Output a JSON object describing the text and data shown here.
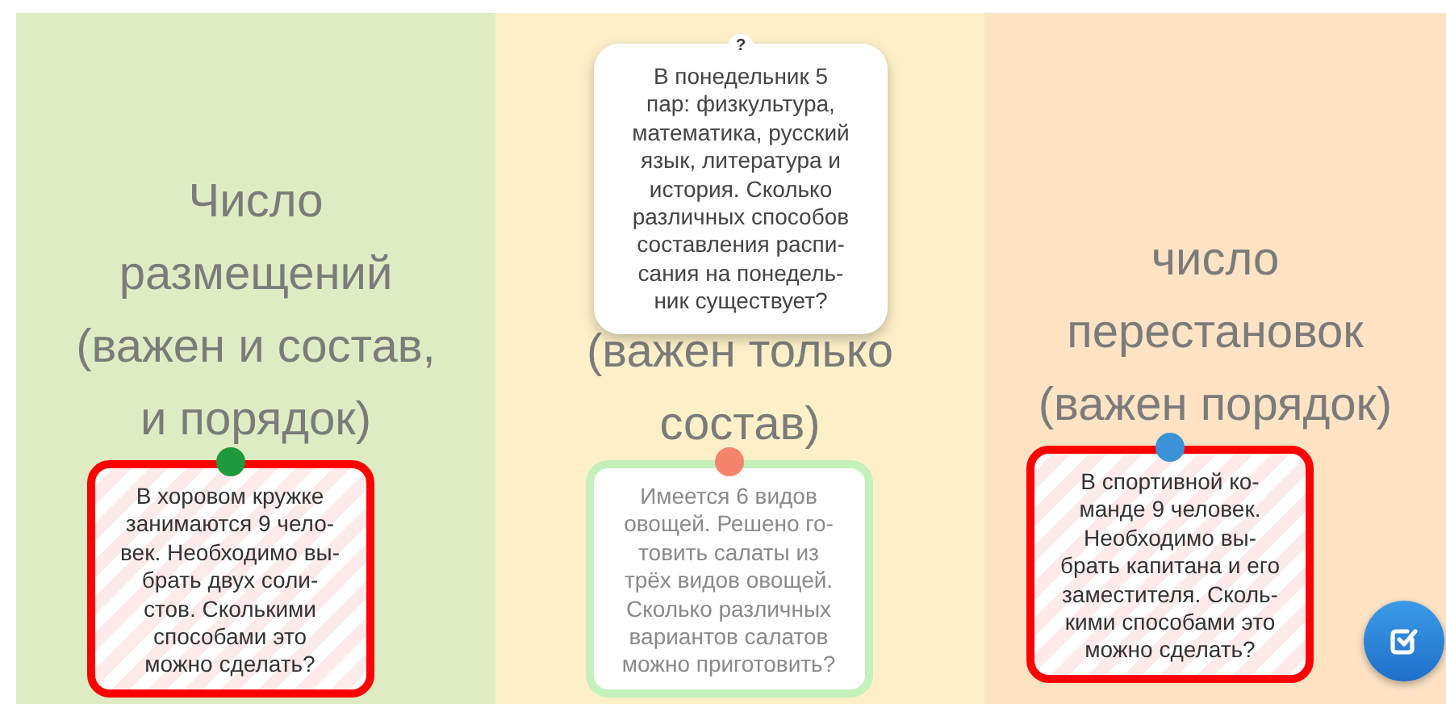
{
  "columns": [
    {
      "heading": "Число размещений (важен и состав, и порядок)",
      "card": {
        "text": "В хоровом кружке\nзанимаются 9 чело-\nвек. Необходимо вы-\nбрать двух соли-\nстов. Сколькими\nспособами это\nможно сделать?",
        "marked_wrong": true,
        "color": "#1e9a3c"
      }
    },
    {
      "heading": "(важен только состав)",
      "card": {
        "text": "Имеется 6 видов\nовощей. Решено го-\nтовить салаты из\nтрёх видов овощей.\nСколько различных\nвариантов салатов\nможно приготовить?",
        "marked_wrong": false,
        "color": "#f4846a"
      }
    },
    {
      "heading": "число перестановок (важен порядок)",
      "card": {
        "text": "В спортивной ко-\nманде 9 человек.\nНеобходимо вы-\nбрать капитана и его\nзаместителя. Сколь-\nкими способами это\nможно сделать?",
        "marked_wrong": true,
        "color": "#3a93d6"
      }
    }
  ],
  "question": {
    "marker": "?",
    "text": "В понедельник 5\nпар: физкультура,\nматематика, русский\nязык, литература и\nистория. Сколько\nразличных способов\nсоставления распи-\nсания на понедель-\nник существует?"
  }
}
